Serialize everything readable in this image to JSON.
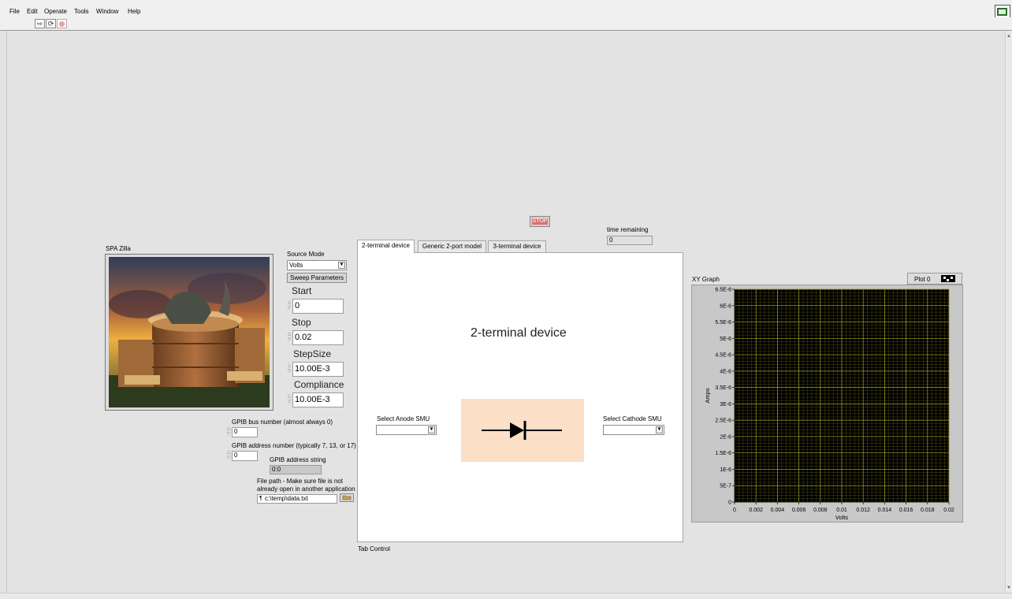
{
  "menu": [
    "File",
    "Edit",
    "Operate",
    "Tools",
    "Window",
    "Help"
  ],
  "toolbar": {
    "run_icon": "run-arrow-icon",
    "run_continuous_icon": "run-continuous-icon",
    "abort_icon": "abort-icon"
  },
  "stop_button": "STOP",
  "time_remaining": {
    "label": "time remaining",
    "value": "0"
  },
  "picture": {
    "label": "SPA Zilla"
  },
  "source_mode": {
    "label": "Source Mode",
    "value": "Volts"
  },
  "sweep_parameters_button": "Sweep Parameters",
  "params": {
    "start": {
      "label": "Start",
      "value": "0"
    },
    "stop": {
      "label": "Stop",
      "value": "0.02"
    },
    "stepsize": {
      "label": "StepSize",
      "value": "10.00E-3"
    },
    "compliance": {
      "label": "Compliance",
      "value": "10.00E-3"
    }
  },
  "gpib": {
    "bus_label": "GPIB bus number (almost always 0)",
    "bus_value": "0",
    "address_label": "GPIB address number (typically 7, 13, or 17)",
    "address_value": "0",
    "address_string_label": "GPIB address string",
    "address_string_value": "0:0"
  },
  "file_path": {
    "label_line1": "File path - Make sure file is not",
    "label_line2": "already open in another application",
    "value": "c:\\temp\\data.txt"
  },
  "tabs": [
    "2-terminal device",
    "Generic 2-port model",
    "3-terminal device"
  ],
  "tab_control_label": "Tab Control",
  "tab_content": {
    "title": "2-terminal device",
    "anode_label": "Select Anode SMU",
    "cathode_label": "Select Cathode SMU"
  },
  "colors": {
    "stop_bg": "#e07070",
    "graph_bg": "#000000",
    "grid": "#a0a020",
    "diode_box": "#fcdfc7"
  },
  "chart_data": {
    "type": "line",
    "title": "XY Graph",
    "legend": "Plot 0",
    "xlabel": "Volts",
    "ylabel": "Amps",
    "xlim": [
      0,
      0.02
    ],
    "ylim": [
      0,
      6.5e-06
    ],
    "x_ticks": [
      "0",
      "0.002",
      "0.004",
      "0.006",
      "0.008",
      "0.01",
      "0.012",
      "0.014",
      "0.016",
      "0.018",
      "0.02"
    ],
    "y_ticks": [
      "0",
      "5E-7",
      "1E-6",
      "1.5E-6",
      "2E-6",
      "2.5E-6",
      "3E-6",
      "3.5E-6",
      "4E-6",
      "4.5E-6",
      "5E-6",
      "5.5E-6",
      "6E-6",
      "6.5E-6"
    ],
    "grid": true,
    "series": [
      {
        "name": "Plot 0",
        "x": [],
        "y": []
      }
    ]
  }
}
